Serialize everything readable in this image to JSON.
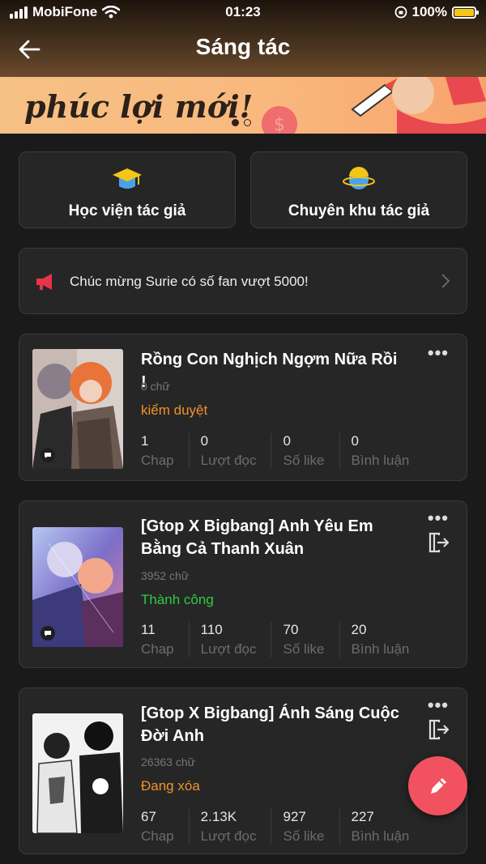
{
  "status_bar": {
    "carrier": "MobiFone",
    "time": "01:23",
    "battery": "100%"
  },
  "header": {
    "title": "Sáng tác"
  },
  "banner": {
    "text": "phúc lợi mới!",
    "page_count": 2,
    "active_page": 1
  },
  "quick_links": [
    {
      "label": "Học viện tác giả",
      "icon": "graduation-cap-icon"
    },
    {
      "label": "Chuyên khu tác giả",
      "icon": "planet-icon"
    }
  ],
  "notice": {
    "text": "Chúc mừng Surie  có số fan vượt 5000!",
    "icon": "megaphone-icon"
  },
  "stories": [
    {
      "title": "Rồng Con Nghịch Ngợm Nữa Rồi !",
      "words": "0 chữ",
      "status": "kiểm duyệt",
      "status_color": "#f0932b",
      "stats": [
        {
          "value": "1",
          "label": "Chap"
        },
        {
          "value": "0",
          "label": "Lượt đọc"
        },
        {
          "value": "0",
          "label": "Số like"
        },
        {
          "value": "0",
          "label": "Bình luận"
        }
      ]
    },
    {
      "title": "[Gtop X Bigbang] Anh Yêu Em Bằng Cả Thanh Xuân",
      "words": "3952 chữ",
      "status": "Thành công",
      "status_color": "#2ecc40",
      "stats": [
        {
          "value": "11",
          "label": "Chap"
        },
        {
          "value": "110",
          "label": "Lượt đọc"
        },
        {
          "value": "70",
          "label": "Số like"
        },
        {
          "value": "20",
          "label": "Bình luận"
        }
      ]
    },
    {
      "title": "[Gtop X Bigbang] Ánh Sáng Cuộc Đời Anh",
      "words": "26363 chữ",
      "status": "Đang xóa",
      "status_color": "#f0932b",
      "stats": [
        {
          "value": "67",
          "label": "Chap"
        },
        {
          "value": "2.13K",
          "label": "Lượt đọc"
        },
        {
          "value": "927",
          "label": "Số like"
        },
        {
          "value": "227",
          "label": "Bình luận"
        }
      ]
    }
  ],
  "colors": {
    "accent": "#f2525f",
    "card_bg": "#262626",
    "page_bg": "#1a1a1a"
  }
}
